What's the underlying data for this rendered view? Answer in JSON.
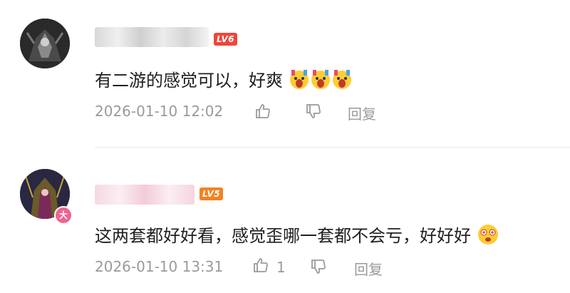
{
  "comments": [
    {
      "level": "LV6",
      "level_color": "#f0453a",
      "text": "有二游的感觉可以，好爽",
      "emoji_count": 3,
      "time": "2026-01-10 12:02",
      "like_count": "",
      "reply_label": "回复"
    },
    {
      "level": "LV5",
      "level_color": "#f58220",
      "badge": "大",
      "text": "这两套都好好看，感觉歪哪一套都不会亏，好好好",
      "emoji_count": 1,
      "time": "2026-01-10 13:31",
      "like_count": "1",
      "reply_label": "回复"
    }
  ]
}
